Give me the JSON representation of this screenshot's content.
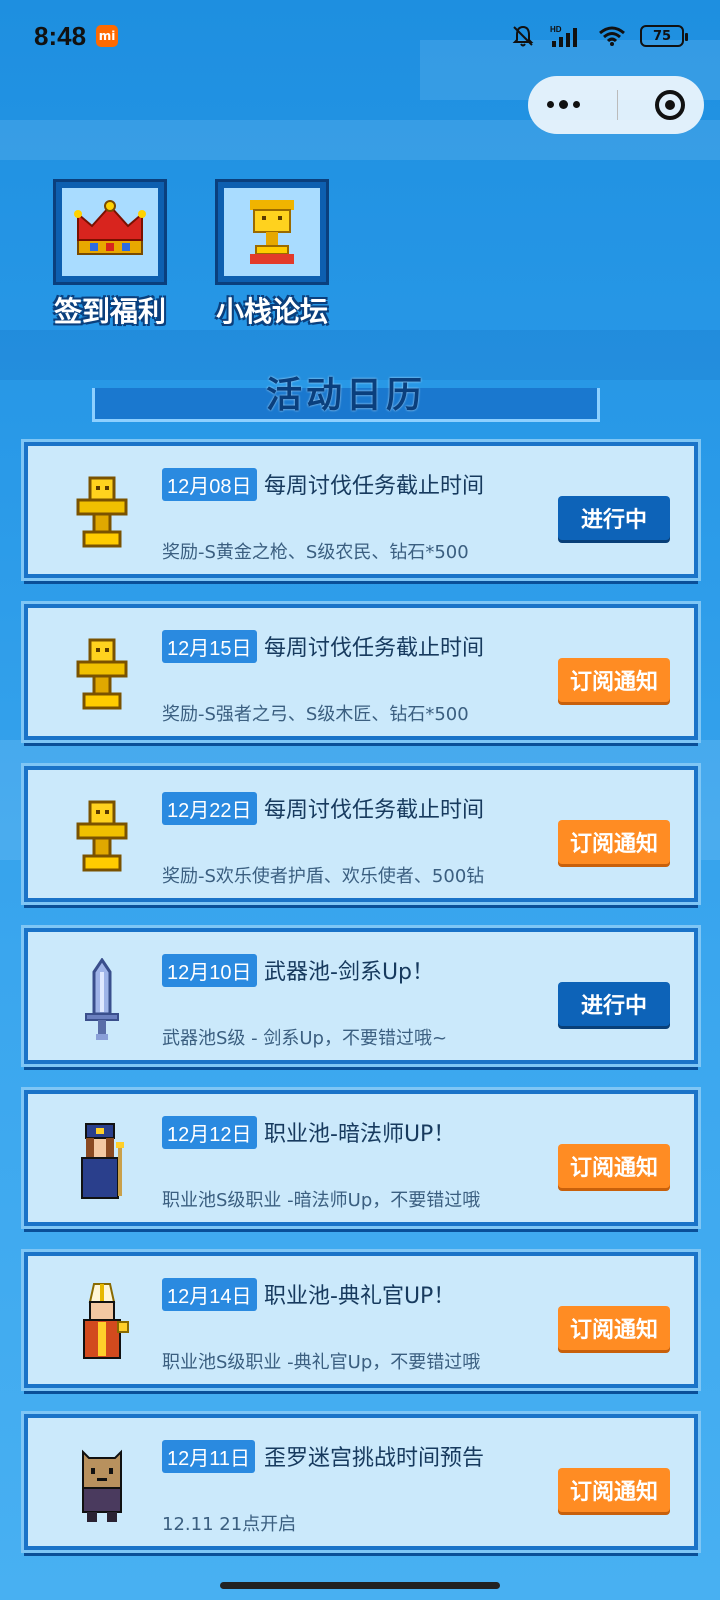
{
  "status_bar": {
    "time": "8:48",
    "carrier_badge": "mi",
    "network": "HD",
    "battery": "75"
  },
  "capsule": {
    "more_icon": "more-dots-icon",
    "close_icon": "target-icon"
  },
  "shortcuts": [
    {
      "label": "签到福利",
      "icon": "crown-icon"
    },
    {
      "label": "小栈论坛",
      "icon": "trophy-icon"
    }
  ],
  "section": {
    "title": "活动日历"
  },
  "events": [
    {
      "date": "12月08日",
      "title": "每周讨伐任务截止时间",
      "desc": "奖励-S黄金之枪、S级农民、钻石*500",
      "button": "进行中",
      "state": "ongoing",
      "icon": "trophy-icon"
    },
    {
      "date": "12月15日",
      "title": "每周讨伐任务截止时间",
      "desc": "奖励-S强者之弓、S级木匠、钻石*500",
      "button": "订阅通知",
      "state": "subscribe",
      "icon": "trophy-icon"
    },
    {
      "date": "12月22日",
      "title": "每周讨伐任务截止时间",
      "desc": "奖励-S欢乐使者护盾、欢乐使者、500钻",
      "button": "订阅通知",
      "state": "subscribe",
      "icon": "trophy-icon"
    },
    {
      "date": "12月10日",
      "title": "武器池-剑系Up！",
      "desc": "武器池S级 - 剑系Up，不要错过哦~",
      "button": "进行中",
      "state": "ongoing",
      "icon": "sword-icon"
    },
    {
      "date": "12月12日",
      "title": "职业池-暗法师UP！",
      "desc": "职业池S级职业 -暗法师Up，不要错过哦",
      "button": "订阅通知",
      "state": "subscribe",
      "icon": "dark-mage-icon"
    },
    {
      "date": "12月14日",
      "title": "职业池-典礼官UP！",
      "desc": "职业池S级职业 -典礼官Up，不要错过哦",
      "button": "订阅通知",
      "state": "subscribe",
      "icon": "ceremony-officer-icon"
    },
    {
      "date": "12月11日",
      "title": "歪罗迷宫挑战时间预告",
      "desc": "12.11 21点开启",
      "button": "订阅通知",
      "state": "subscribe",
      "icon": "wairo-icon"
    }
  ],
  "colors": {
    "ongoing_button": "#0d63b8",
    "subscribe_button": "#ff8c23",
    "date_tag": "#2a8ae0",
    "card_bg": "#cbe9fb"
  }
}
